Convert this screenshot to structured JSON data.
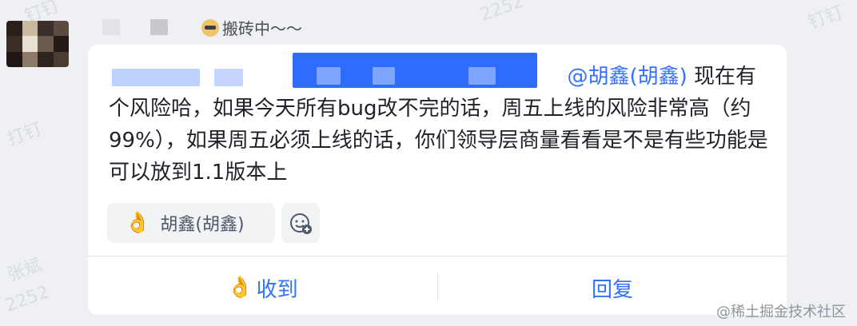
{
  "watermarks": [
    "2252",
    "钉钉",
    "打钉",
    "张斌",
    "2252",
    "钉钉"
  ],
  "sender": {
    "status_text": "搬砖中～～",
    "status_icon": "worker-emoji-icon"
  },
  "message": {
    "mention": "@胡鑫(胡鑫)",
    "line1_rest": " 现在有",
    "body": "个风险哈，如果今天所有bug改不完的话，周五上线的风险非常高（约99%），如果周五必须上线的话，你们领导层商量看看是不是有些功能是可以放到1.1版本上"
  },
  "reactions": [
    {
      "emoji": "👌",
      "users": "胡鑫(胡鑫)"
    }
  ],
  "actions": {
    "receive_label": "收到",
    "receive_emoji": "👌",
    "reply_label": "回复"
  },
  "brand": "@稀土掘金技术社区",
  "colors": {
    "accent": "#3370ff",
    "card_bg": "#ffffff",
    "page_bg": "#eef0f3"
  }
}
